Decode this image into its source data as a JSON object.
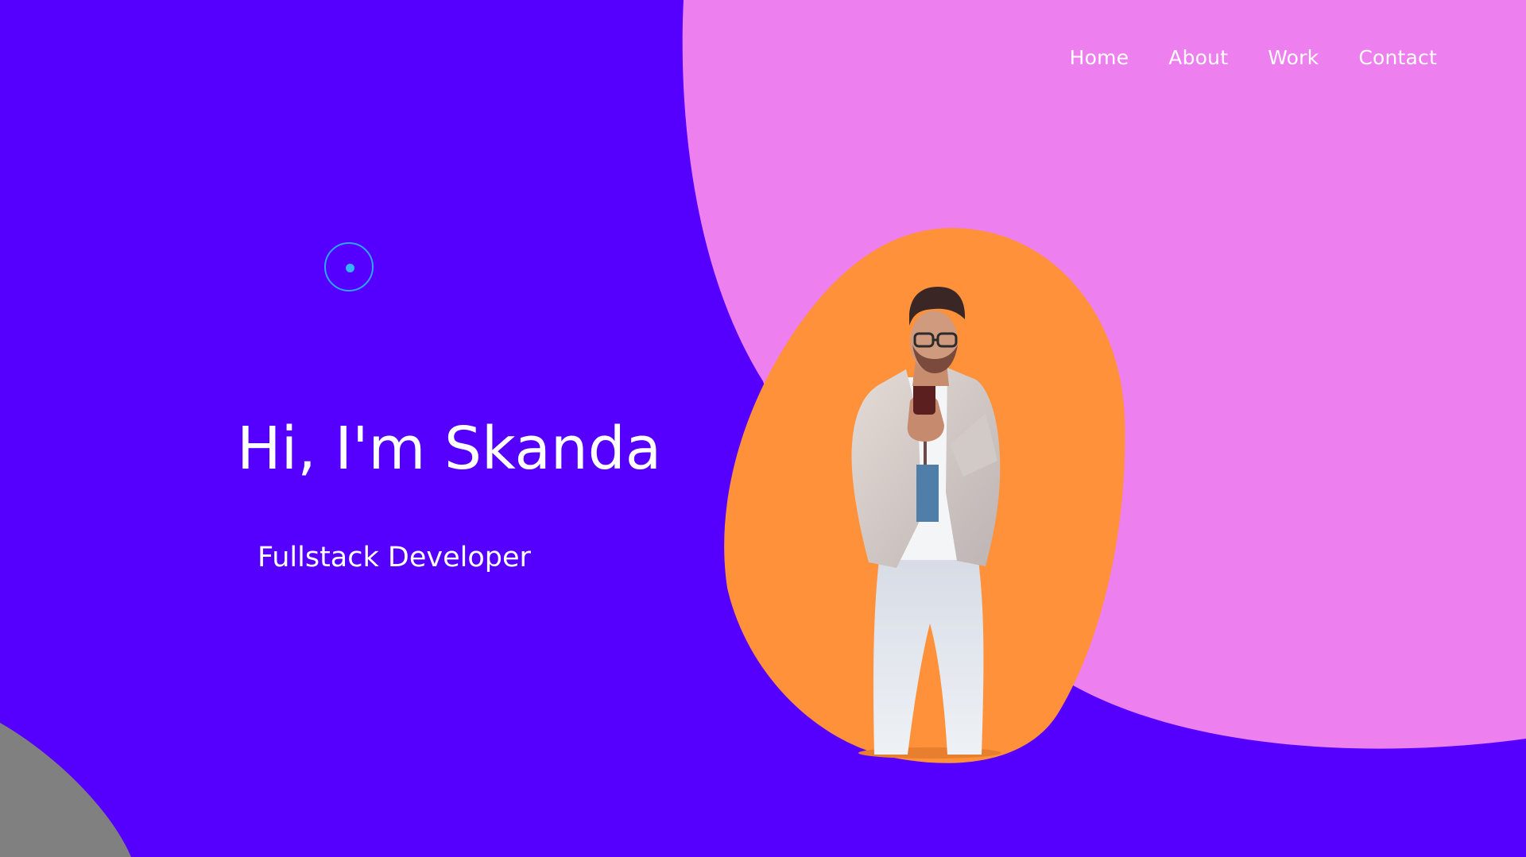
{
  "nav": {
    "items": [
      {
        "label": "Home"
      },
      {
        "label": "About"
      },
      {
        "label": "Work"
      },
      {
        "label": "Contact"
      }
    ]
  },
  "hero": {
    "title": "Hi, I'm Skanda",
    "subtitle": "Fullstack Developer"
  },
  "colors": {
    "background": "#5500ff",
    "blob_pink": "#ee7fee",
    "blob_orange": "#ff913b",
    "corner_gray": "#808080",
    "cursor_ring": "#2ea6ff",
    "text": "#ffffff"
  }
}
